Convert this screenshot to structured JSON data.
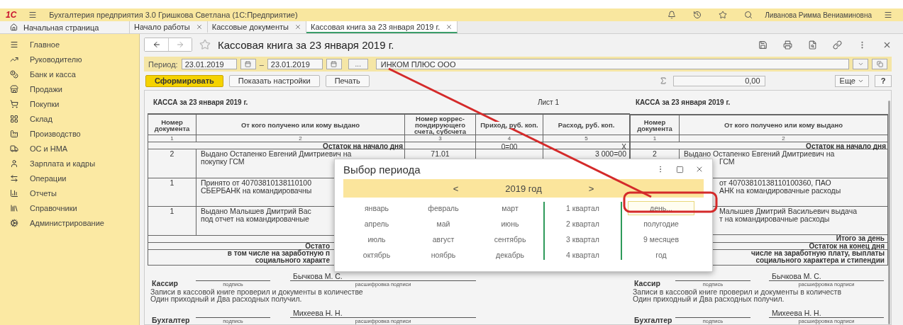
{
  "app_bar": {
    "logo": "1С",
    "title": "Бухгалтерия предприятия 3.0 Гришкова Светлана  (1С:Предприятие)",
    "user": "Ливанова Римма Вениаминовна"
  },
  "home_tab": {
    "label": "Начальная страница"
  },
  "tabs": [
    {
      "label": "Начало работы",
      "selected": false
    },
    {
      "label": "Кассовые документы",
      "selected": false
    },
    {
      "label": "Кассовая книга за 23 января 2019 г.",
      "selected": true
    }
  ],
  "sidebar": {
    "items": [
      {
        "label": "Главное"
      },
      {
        "label": "Руководителю"
      },
      {
        "label": "Банк и касса"
      },
      {
        "label": "Продажи"
      },
      {
        "label": "Покупки"
      },
      {
        "label": "Склад"
      },
      {
        "label": "Производство"
      },
      {
        "label": "ОС и НМА"
      },
      {
        "label": "Зарплата и кадры"
      },
      {
        "label": "Операции"
      },
      {
        "label": "Отчеты"
      },
      {
        "label": "Справочники"
      },
      {
        "label": "Администрирование"
      }
    ]
  },
  "form": {
    "title": "Кассовая книга за 23 января 2019 г.",
    "period_label": "Период:",
    "date_from": "23.01.2019",
    "dash": "–",
    "date_to": "23.01.2019",
    "choose_button": "...",
    "organization": "ИНКОМ ПЛЮС ООО",
    "buttons": [
      {
        "label": "Сформировать",
        "kind": "primary"
      },
      {
        "label": "Показать настройки",
        "kind": "normal"
      },
      {
        "label": "Печать",
        "kind": "normal"
      }
    ],
    "sum_value": "0,00",
    "more_button": "Еще",
    "help_button": "?"
  },
  "report": {
    "sheet_label": "Лист 1",
    "copies": [
      {
        "title": "КАССА за 23 января 2019 г.",
        "columns": [
          "Номер документа",
          "От кого получено или кому выдано",
          "Номер коррес-пондирующего счета, субсчета",
          "Приход, руб. коп.",
          "Расход, руб. коп."
        ],
        "column_numbers": [
          "1",
          "2",
          "3",
          "4",
          "5"
        ],
        "opening": {
          "label": "Остаток на начало дня",
          "income": "0=00",
          "expense": "X"
        },
        "entries": [
          {
            "number": "2",
            "lines": [
              "Выдано Остапенко Евгений Дмитриевич на",
              "покупку ГСМ"
            ],
            "account": "71.01",
            "expense": "3 000=00"
          },
          {
            "number": "1",
            "lines": [
              "Принято от 40703810138110100",
              "СБЕРБАНК на командировачны"
            ]
          },
          {
            "number": "1",
            "lines": [
              "Выдано Малышев Дмитрий Вас",
              "под отчет на командировачные"
            ]
          }
        ],
        "totals": [
          {
            "lines": [
              "Остато"
            ]
          },
          {
            "lines": [
              "в том числе на заработную п",
              "социального характе"
            ]
          }
        ],
        "signatures": [
          {
            "role": "Кассир",
            "name": "Бычкова М. С.",
            "sign_caption": "подпись",
            "name_caption": "расшифровка подписи"
          },
          {
            "role": "Бухгалтер",
            "name": "Михеева Н. Н.",
            "sign_caption": "подпись",
            "name_caption": "расшифровка подписи"
          }
        ],
        "note": [
          "Записи в кассовой книге проверил и документы в количестве",
          "Один приходный и Два расходных получил."
        ]
      },
      {
        "title": "КАССА за 23 января 2019 г.",
        "columns": [
          "Номер документа",
          "От кого получено или кому выдано"
        ],
        "column_numbers": [
          "1",
          "2"
        ],
        "opening": {
          "label": "Остаток на начало дня"
        },
        "entries": [
          {
            "number": "2",
            "lines": [
              "Выдано Остапенко Евгений Дмитриевич на",
              "ГСМ"
            ]
          },
          {
            "lines": [
              "от 40703810138110100360, ПАО",
              "АНК на командировачные расходы"
            ]
          },
          {
            "lines": [
              "Малышев Дмитрий Васильевич выдача",
              "т на командировачные расходы"
            ]
          }
        ],
        "totals": [
          {
            "lines": [
              "Итого за день"
            ]
          },
          {
            "lines": [
              "Остаток на конец  дня"
            ]
          },
          {
            "lines": [
              "числе на заработную плату, выплаты",
              "социального характера и стипендии"
            ]
          }
        ],
        "signatures": [
          {
            "role": "Кассир",
            "name": "Бычкова М. С.",
            "sign_caption": "подпись",
            "name_caption": "расшифровка подписи"
          },
          {
            "role": "Бухгалтер",
            "name": "Михеева Н. Н.",
            "sign_caption": "подпись",
            "name_caption": "расшифровка подписи"
          }
        ],
        "note": [
          "Записи в кассовой книге проверил и документы в количеств",
          "Один приходный и Два расходных получил."
        ]
      }
    ]
  },
  "period_dialog": {
    "title": "Выбор периода",
    "prev": "<",
    "year": "2019 год",
    "next": ">",
    "months": [
      {
        "label": "январь",
        "selected": false
      },
      {
        "label": "февраль",
        "selected": false
      },
      {
        "label": "март",
        "selected": false
      },
      {
        "label": "апрель",
        "selected": false
      },
      {
        "label": "май",
        "selected": false
      },
      {
        "label": "июнь",
        "selected": false
      },
      {
        "label": "июль",
        "selected": false
      },
      {
        "label": "август",
        "selected": false
      },
      {
        "label": "сентябрь",
        "selected": false
      },
      {
        "label": "октябрь",
        "selected": false
      },
      {
        "label": "ноябрь",
        "selected": false
      },
      {
        "label": "декабрь",
        "selected": false
      }
    ],
    "quarters": [
      {
        "label": "1 квартал",
        "selected": false
      },
      {
        "label": "2 квартал",
        "selected": false
      },
      {
        "label": "3 квартал",
        "selected": false
      },
      {
        "label": "4 квартал",
        "selected": false
      }
    ],
    "periods": [
      {
        "label": "день...",
        "selected": true
      },
      {
        "label": "полугодие",
        "selected": false
      },
      {
        "label": "9 месяцев",
        "selected": false
      },
      {
        "label": "год",
        "selected": false
      }
    ]
  }
}
